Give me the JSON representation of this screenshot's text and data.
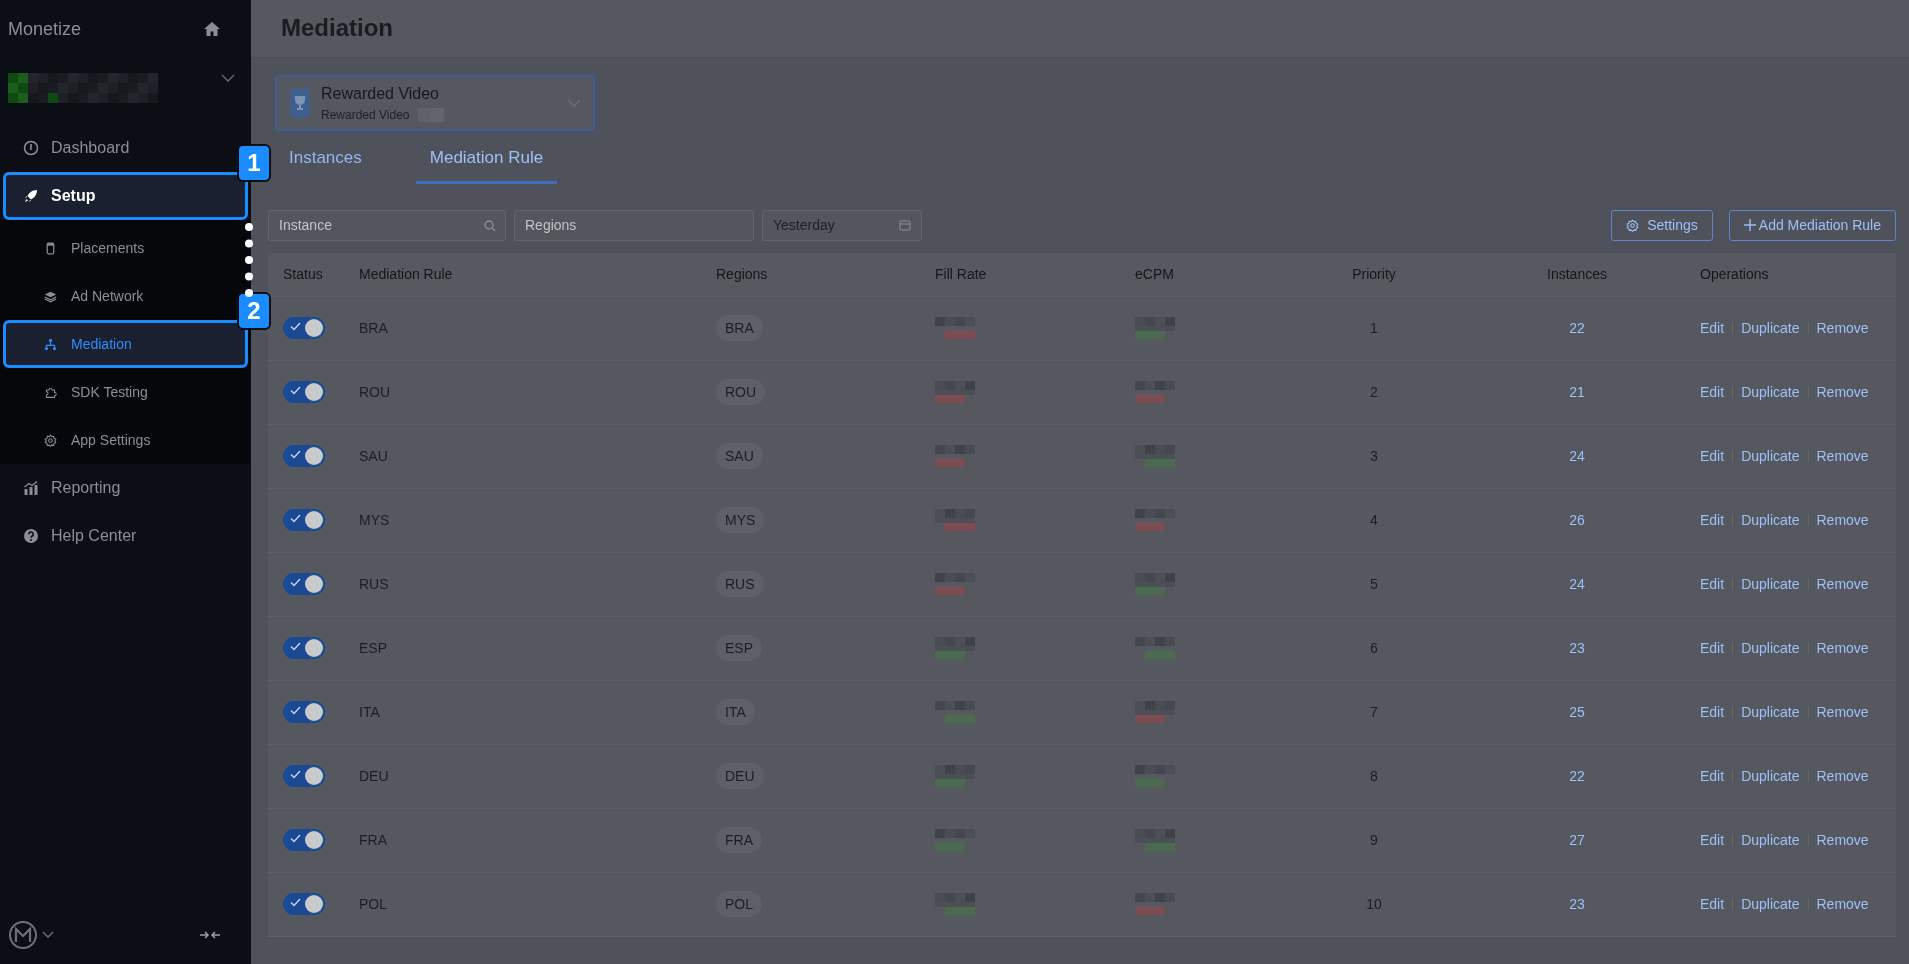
{
  "sidebar": {
    "title": "Monetize",
    "items": [
      {
        "label": "Dashboard",
        "selected": false
      },
      {
        "label": "Setup",
        "selected": true,
        "expanded": true,
        "callout": "1",
        "children": [
          {
            "label": "Placements",
            "selected": false
          },
          {
            "label": "Ad Network",
            "selected": false
          },
          {
            "label": "Mediation",
            "selected": true,
            "callout": "2"
          },
          {
            "label": "SDK Testing",
            "selected": false
          },
          {
            "label": "App Settings",
            "selected": false
          }
        ]
      },
      {
        "label": "Reporting",
        "selected": false
      },
      {
        "label": "Help Center",
        "selected": false
      }
    ]
  },
  "page_title": "Mediation",
  "placement_select": {
    "title": "Rewarded Video",
    "subtitle": "Rewarded Video"
  },
  "tabs": [
    {
      "label": "Instances",
      "selected": false
    },
    {
      "label": "Mediation Rule",
      "selected": true
    }
  ],
  "filters": [
    {
      "kind": "search",
      "placeholder": "Instance"
    },
    {
      "kind": "select",
      "placeholder": "Regions"
    },
    {
      "kind": "date",
      "value": "Yesterday"
    }
  ],
  "buttons": [
    {
      "kind": "settings",
      "label": "Settings"
    },
    {
      "kind": "add",
      "label": "Add Mediation Rule"
    }
  ],
  "table": {
    "columns": [
      "Status",
      "Mediation Rule",
      "Regions",
      "Fill Rate",
      "eCPM",
      "Priority",
      "Instances",
      "Operations"
    ],
    "rows": [
      {
        "on": true,
        "rule": "BRA",
        "region": "BRA",
        "fill_rate": {
          "color": "#7d4d52"
        },
        "ecpm": {
          "color": "#4c6b4e"
        },
        "priority": "1",
        "instances": "22",
        "operations": [
          "Edit",
          "Duplicate",
          "Remove"
        ]
      },
      {
        "on": true,
        "rule": "ROU",
        "region": "ROU",
        "fill_rate": {
          "color": "#7d4d52"
        },
        "ecpm": {
          "color": "#7d4d52"
        },
        "priority": "2",
        "instances": "21",
        "operations": [
          "Edit",
          "Duplicate",
          "Remove"
        ]
      },
      {
        "on": true,
        "rule": "SAU",
        "region": "SAU",
        "fill_rate": {
          "color": "#7d4d52"
        },
        "ecpm": {
          "color": "#4c6b4e"
        },
        "priority": "3",
        "instances": "24",
        "operations": [
          "Edit",
          "Duplicate",
          "Remove"
        ]
      },
      {
        "on": true,
        "rule": "MYS",
        "region": "MYS",
        "fill_rate": {
          "color": "#7d4d52"
        },
        "ecpm": {
          "color": "#7d4d52"
        },
        "priority": "4",
        "instances": "26",
        "operations": [
          "Edit",
          "Duplicate",
          "Remove"
        ]
      },
      {
        "on": true,
        "rule": "RUS",
        "region": "RUS",
        "fill_rate": {
          "color": "#7d4d52"
        },
        "ecpm": {
          "color": "#4c6b4e"
        },
        "priority": "5",
        "instances": "24",
        "operations": [
          "Edit",
          "Duplicate",
          "Remove"
        ]
      },
      {
        "on": true,
        "rule": "ESP",
        "region": "ESP",
        "fill_rate": {
          "color": "#4c6b4e"
        },
        "ecpm": {
          "color": "#4c6b4e"
        },
        "priority": "6",
        "instances": "23",
        "operations": [
          "Edit",
          "Duplicate",
          "Remove"
        ]
      },
      {
        "on": true,
        "rule": "ITA",
        "region": "ITA",
        "fill_rate": {
          "color": "#4c6b4e"
        },
        "ecpm": {
          "color": "#7d4d52"
        },
        "priority": "7",
        "instances": "25",
        "operations": [
          "Edit",
          "Duplicate",
          "Remove"
        ]
      },
      {
        "on": true,
        "rule": "DEU",
        "region": "DEU",
        "fill_rate": {
          "color": "#4c6b4e"
        },
        "ecpm": {
          "color": "#4c6b4e"
        },
        "priority": "8",
        "instances": "22",
        "operations": [
          "Edit",
          "Duplicate",
          "Remove"
        ]
      },
      {
        "on": true,
        "rule": "FRA",
        "region": "FRA",
        "fill_rate": {
          "color": "#4c6b4e"
        },
        "ecpm": {
          "color": "#4c6b4e"
        },
        "priority": "9",
        "instances": "27",
        "operations": [
          "Edit",
          "Duplicate",
          "Remove"
        ]
      },
      {
        "on": true,
        "rule": "POL",
        "region": "POL",
        "fill_rate": {
          "color": "#4c6b4e"
        },
        "ecpm": {
          "color": "#7d4d52"
        },
        "priority": "10",
        "instances": "23",
        "operations": [
          "Edit",
          "Duplicate",
          "Remove"
        ]
      }
    ]
  }
}
